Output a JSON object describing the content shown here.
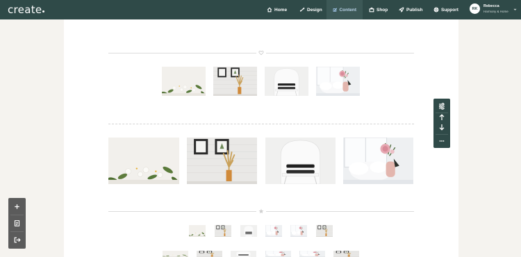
{
  "app": {
    "logo_text": "create",
    "nav": [
      {
        "label": "Home",
        "icon": "home-icon"
      },
      {
        "label": "Design",
        "icon": "brush-icon"
      },
      {
        "label": "Content",
        "icon": "edit-icon",
        "active": true
      },
      {
        "label": "Shop",
        "icon": "shop-icon"
      },
      {
        "label": "Publish",
        "icon": "rocket-icon"
      },
      {
        "label": "Support",
        "icon": "lifebuoy-icon"
      }
    ],
    "user": {
      "initials": "RK",
      "name": "Rebecca",
      "subtitle": "Harmony & Home"
    }
  },
  "colors": {
    "topbar": "#2f4a48",
    "active_tab": "#3c5856",
    "active_text": "#b9d1e6",
    "page_bg": "#f5f3ef",
    "canvas": "#ffffff",
    "right_toolbar": "#2f4a48",
    "left_toolbar": "#5b5b5b"
  },
  "photos": [
    "cotton-flowers-photo",
    "wall-frames-dried-grass-photo",
    "white-chair-towels-photo",
    "pink-rose-vase-window-photo"
  ],
  "right_toolbar": [
    {
      "icon": "sliders-icon"
    },
    {
      "icon": "arrow-up-icon"
    },
    {
      "icon": "arrow-down-icon"
    },
    {
      "icon": "more-dots-icon"
    }
  ],
  "left_toolbar": [
    {
      "icon": "plus-icon"
    },
    {
      "icon": "page-icon"
    },
    {
      "icon": "exit-icon"
    }
  ]
}
